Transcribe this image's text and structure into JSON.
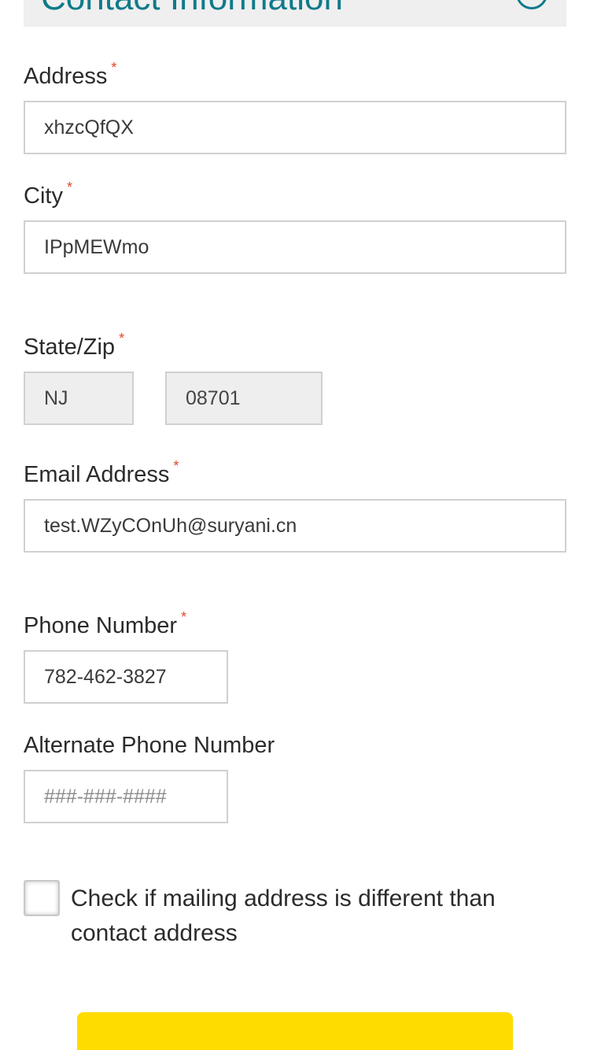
{
  "section": {
    "title": "Contact Information"
  },
  "fields": {
    "address": {
      "label": "Address",
      "required": "*",
      "value": "xhzcQfQX"
    },
    "city": {
      "label": "City",
      "required": "*",
      "value": "IPpMEWmo"
    },
    "state_zip": {
      "label": "State/Zip",
      "required": "*",
      "state": "NJ",
      "zip": "08701"
    },
    "email": {
      "label": "Email Address",
      "required": "*",
      "value": "test.WZyCOnUh@suryani.cn"
    },
    "phone": {
      "label": "Phone Number",
      "required": "*",
      "value": "782-462-3827"
    },
    "alt_phone": {
      "label": "Alternate Phone Number",
      "value": "",
      "placeholder": "###-###-####"
    }
  },
  "mailing_checkbox": {
    "label": "Check if mailing address is different than contact address",
    "checked": false
  },
  "colors": {
    "accent": "#0f7a8a",
    "required": "#e2452a",
    "button": "#ffdc00",
    "disabled_bg": "#eeeeee"
  }
}
